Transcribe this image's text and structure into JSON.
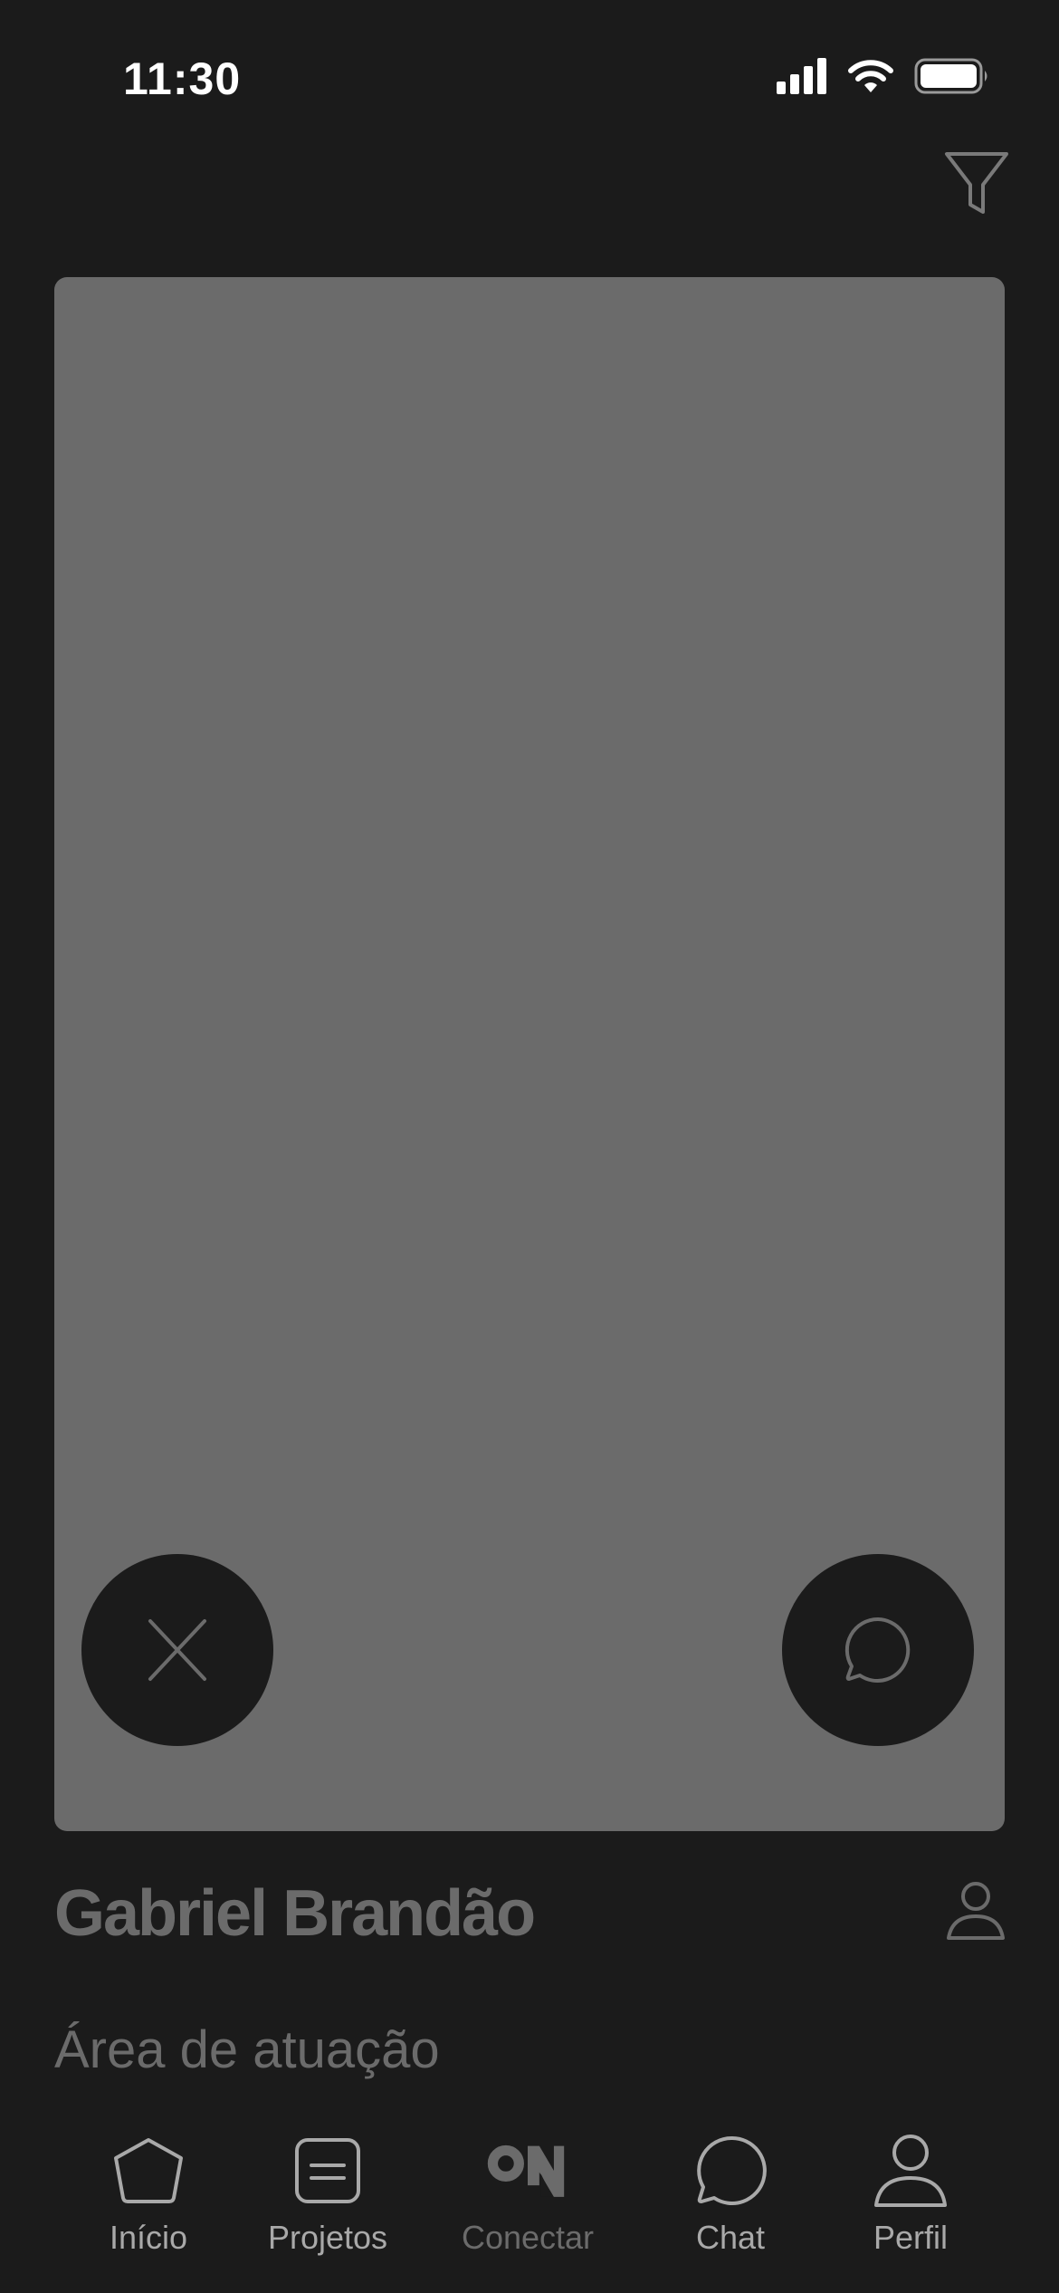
{
  "status_bar": {
    "time": "11:30"
  },
  "profile": {
    "name": "Gabriel Brandão",
    "area_label": "Área de atuação"
  },
  "tabs": [
    {
      "label": "Início",
      "icon": "home-pentagon-icon"
    },
    {
      "label": "Projetos",
      "icon": "document-list-icon"
    },
    {
      "label": "Conectar",
      "icon": "on-logo-icon",
      "active": true
    },
    {
      "label": "Chat",
      "icon": "chat-bubble-icon"
    },
    {
      "label": "Perfil",
      "icon": "user-icon"
    }
  ],
  "colors": {
    "background": "#1b1b1b",
    "card": "#6b6b6b",
    "muted_text": "#6b6b6b",
    "tab_label": "#a9a9a9"
  }
}
